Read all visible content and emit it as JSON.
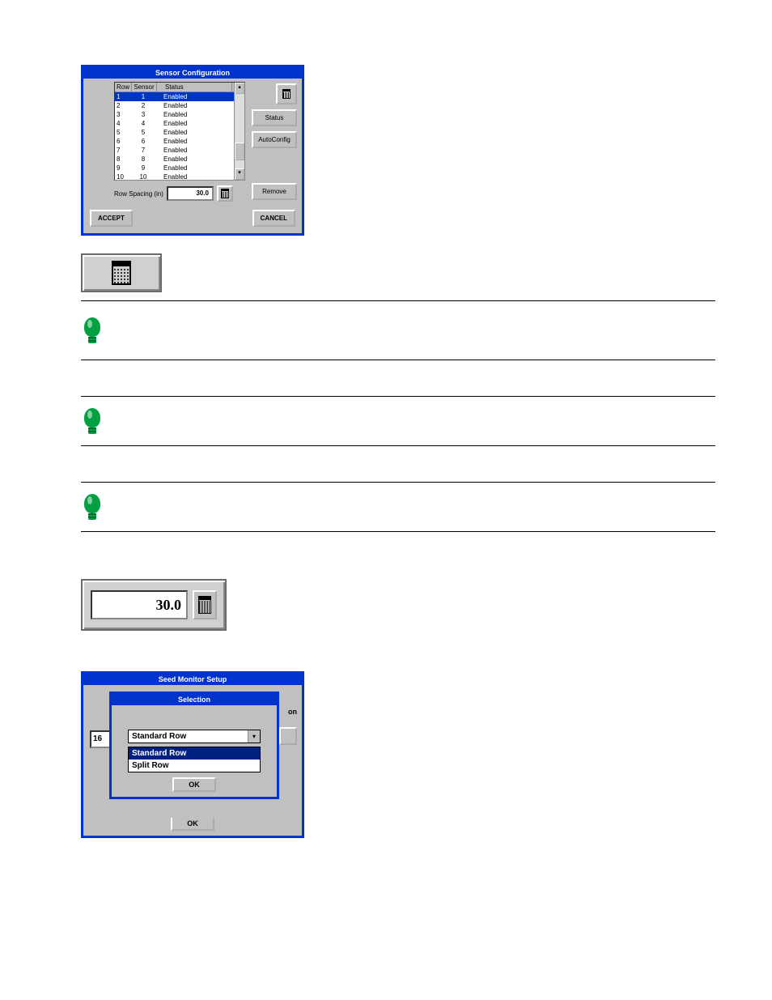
{
  "sensor_window": {
    "title": "Sensor Configuration",
    "columns": {
      "row": "Row",
      "sensor": "Sensor",
      "status": "Status"
    },
    "rows": [
      {
        "row": "1",
        "sensor": "1",
        "status": "Enabled",
        "selected": true
      },
      {
        "row": "2",
        "sensor": "2",
        "status": "Enabled",
        "selected": false
      },
      {
        "row": "3",
        "sensor": "3",
        "status": "Enabled",
        "selected": false
      },
      {
        "row": "4",
        "sensor": "4",
        "status": "Enabled",
        "selected": false
      },
      {
        "row": "5",
        "sensor": "5",
        "status": "Enabled",
        "selected": false
      },
      {
        "row": "6",
        "sensor": "6",
        "status": "Enabled",
        "selected": false
      },
      {
        "row": "7",
        "sensor": "7",
        "status": "Enabled",
        "selected": false
      },
      {
        "row": "8",
        "sensor": "8",
        "status": "Enabled",
        "selected": false
      },
      {
        "row": "9",
        "sensor": "9",
        "status": "Enabled",
        "selected": false
      },
      {
        "row": "10",
        "sensor": "10",
        "status": "Enabled",
        "selected": false
      }
    ],
    "row_spacing_label": "Row Spacing (in)",
    "row_spacing_value": "30.0",
    "buttons": {
      "calc": "calculator-icon",
      "status": "Status",
      "autoconfig": "AutoConfig",
      "remove": "Remove",
      "accept": "ACCEPT",
      "cancel": "CANCEL"
    }
  },
  "row_spacing_figure": {
    "value": "30.0"
  },
  "seed_window": {
    "title": "Seed Monitor Setup",
    "under_left_value": "16",
    "under_right_text": "on",
    "ok_under": "OK",
    "selection": {
      "title": "Selection",
      "selected": "Standard Row",
      "options": [
        "Standard Row",
        "Split Row"
      ],
      "selected_index": 0,
      "ok": "OK"
    }
  }
}
